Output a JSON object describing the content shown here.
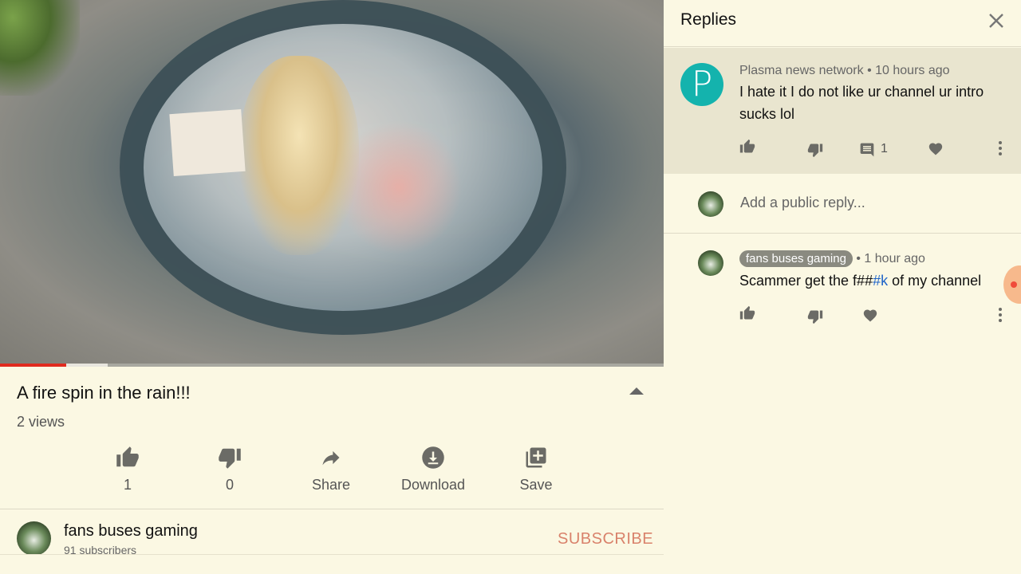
{
  "video": {
    "progress_played_fraction": 0.1,
    "progress_buffered_fraction": 0.163,
    "colors": {
      "played": "#e02a1e"
    }
  },
  "info": {
    "title": "A fire spin in the rain!!!",
    "views": "2 views",
    "actions": {
      "like_count": "1",
      "dislike_count": "0",
      "share_label": "Share",
      "download_label": "Download",
      "save_label": "Save"
    }
  },
  "channel": {
    "name": "fans buses gaming",
    "subscribers": "91 subscribers",
    "subscribe_label": "SUBSCRIBE"
  },
  "replies_panel": {
    "title": "Replies",
    "parent_comment": {
      "author": "Plasma news network",
      "separator_time": "• 10 hours ago",
      "avatar_letter": "P",
      "avatar_color": "#14b3ad",
      "text": "I hate it I do not like ur channel ur intro sucks lol",
      "reply_count": "1"
    },
    "reply_input_placeholder": "Add a public reply...",
    "reply": {
      "author": "fans buses gaming",
      "separator_time": "• 1 hour ago",
      "text_before": "Scammer get the f##",
      "text_hash": "#k",
      "text_after": " of my channel"
    }
  }
}
